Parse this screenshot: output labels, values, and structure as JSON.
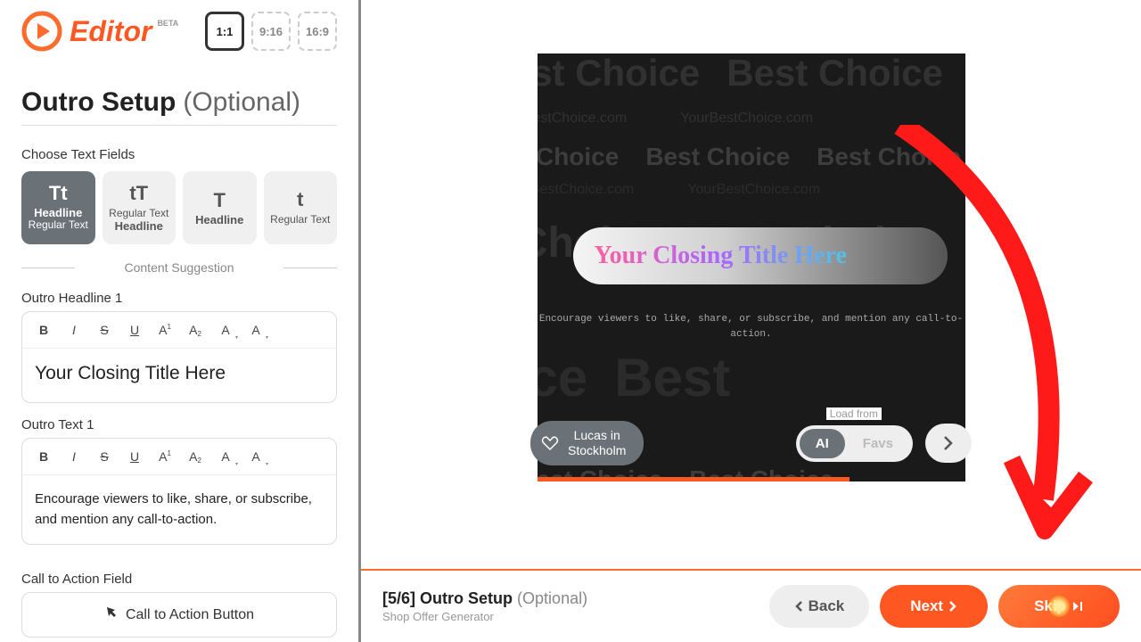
{
  "logo": {
    "text": "Editor",
    "beta": "BETA"
  },
  "ratios": [
    "1:1",
    "9:16",
    "16:9"
  ],
  "page": {
    "title": "Outro Setup",
    "optional": "(Optional)"
  },
  "choose_label": "Choose Text Fields",
  "field_cards": [
    {
      "icon": "Tt",
      "l1": "Headline",
      "l2": "Regular Text"
    },
    {
      "icon": "tT",
      "l1": "Regular Text",
      "l2": "Headline"
    },
    {
      "icon": "T",
      "l1": "Headline",
      "l2": ""
    },
    {
      "icon": "t",
      "l1": "Regular Text",
      "l2": ""
    }
  ],
  "content_suggestion": "Content Suggestion",
  "headline_label": "Outro Headline 1",
  "headline_value": "Your Closing Title Here",
  "text_label": "Outro Text 1",
  "text_value": "Encourage viewers to like, share, or subscribe, and mention any call-to-action.",
  "cta_label": "Call to Action Field",
  "cta_button": "Call to Action Button",
  "preview": {
    "bg_big": "Best Choice",
    "bg_url_a": "urBestChoice.com",
    "bg_url_b": "YourBestChoice.com",
    "title": "Your Closing Title Here",
    "subtext": "Encourage viewers to like, share, or\nsubscribe, and mention any call-to-action."
  },
  "lucas": {
    "line1": "Lucas in",
    "line2": "Stockholm"
  },
  "load": {
    "label": "Load from",
    "ai": "AI",
    "favs": "Favs"
  },
  "footer": {
    "step_num": "[5/6]",
    "step_title": "Outro Setup",
    "step_opt": "(Optional)",
    "generator": "Shop Offer Generator",
    "back": "Back",
    "next": "Next",
    "skip": "Skip"
  }
}
